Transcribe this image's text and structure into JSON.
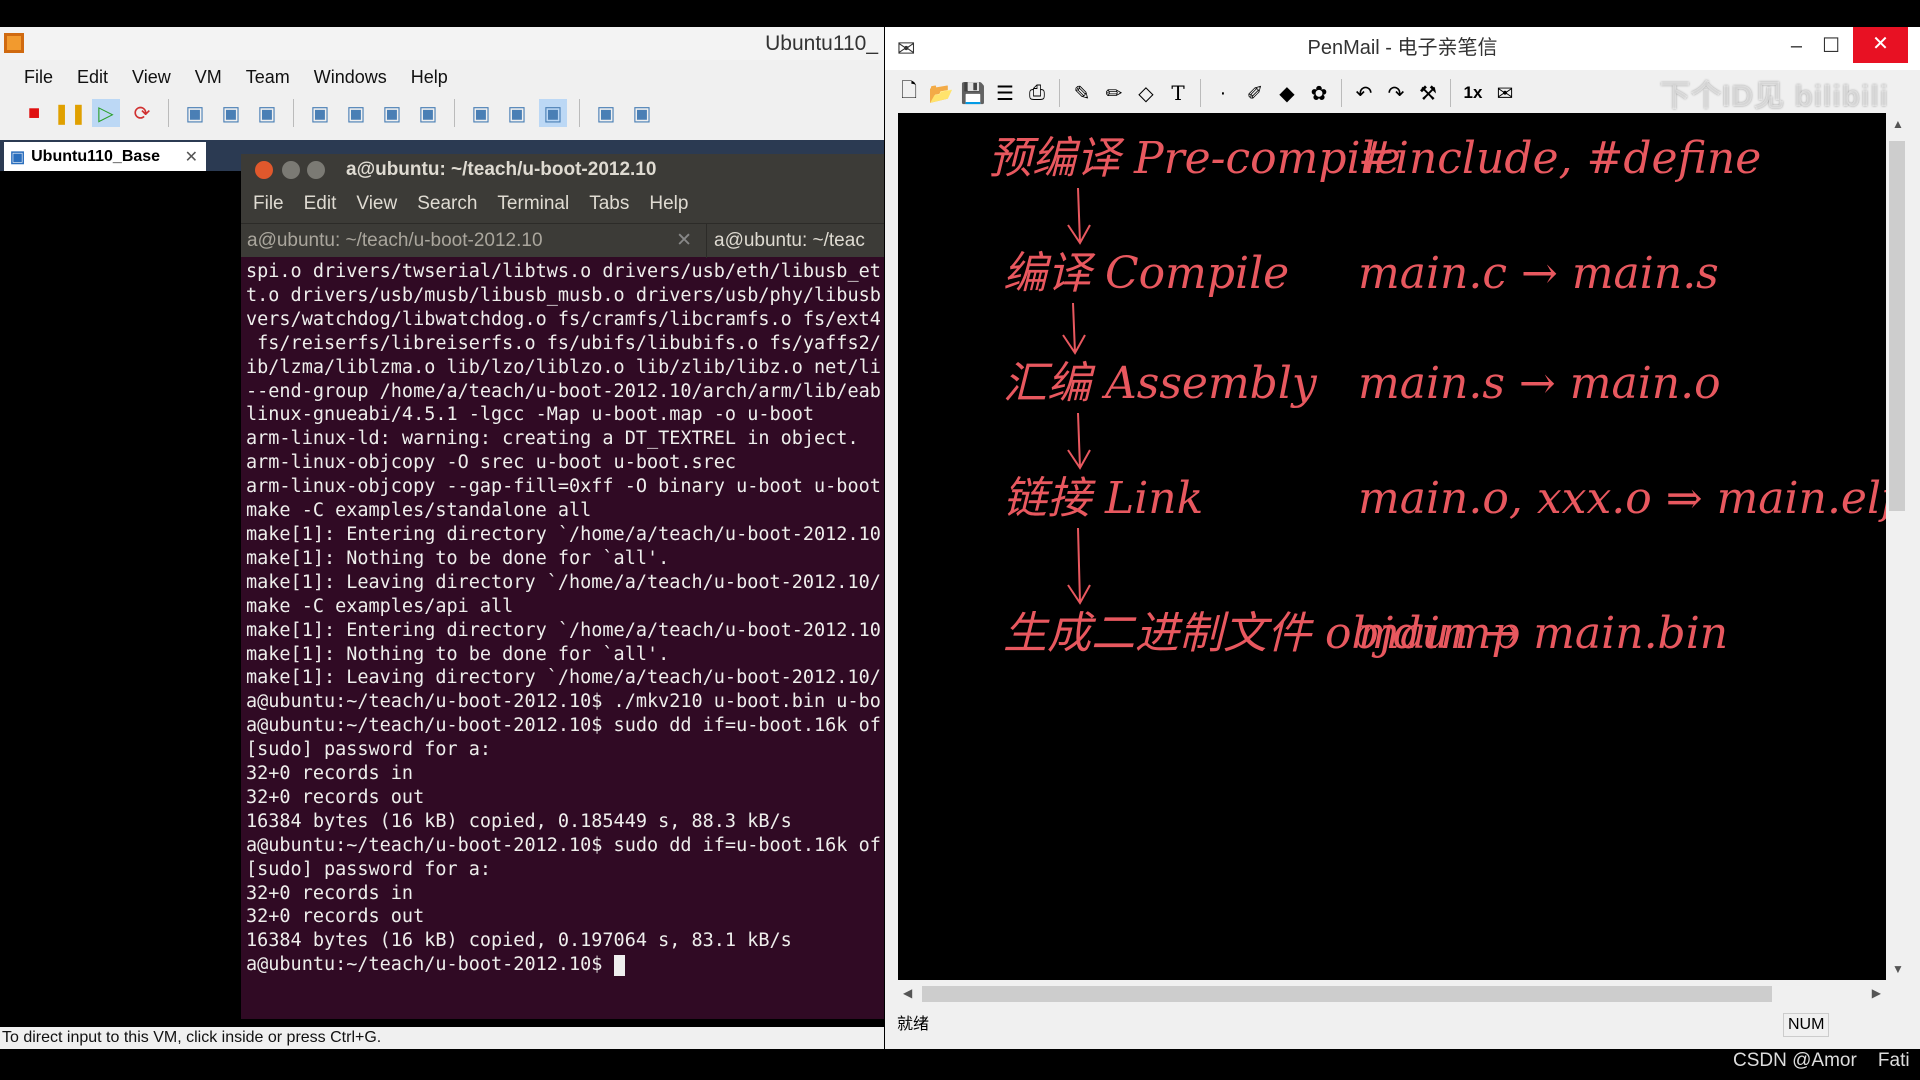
{
  "vmware": {
    "title": "Ubuntu110_",
    "menu": [
      "File",
      "Edit",
      "View",
      "VM",
      "Team",
      "Windows",
      "Help"
    ],
    "toolbar_icons": [
      "stop-icon",
      "pause-icon",
      "play-icon",
      "reset-icon",
      "snapshot-icon",
      "revert-snapshot-icon",
      "snapshot-manager-icon",
      "console-view-icon",
      "fit-guest-icon",
      "full-screen-icon",
      "unity-icon",
      "library-icon",
      "thumbnail-icon",
      "quick-switch-icon",
      "removable-device-icon",
      "share-icon"
    ],
    "tab": "Ubuntu110_Base",
    "status": "To direct input to this VM, click inside or press Ctrl+G."
  },
  "terminal": {
    "title": "a@ubuntu: ~/teach/u-boot-2012.10",
    "menu": [
      "File",
      "Edit",
      "View",
      "Search",
      "Terminal",
      "Tabs",
      "Help"
    ],
    "tabs": [
      "a@ubuntu: ~/teach/u-boot-2012.10",
      "a@ubuntu: ~/teac"
    ],
    "lines": [
      "spi.o drivers/twserial/libtws.o drivers/usb/eth/libusb_et",
      "t.o drivers/usb/musb/libusb_musb.o drivers/usb/phy/libusb",
      "vers/watchdog/libwatchdog.o fs/cramfs/libcramfs.o fs/ext4",
      " fs/reiserfs/libreiserfs.o fs/ubifs/libubifs.o fs/yaffs2/",
      "ib/lzma/liblzma.o lib/lzo/liblzo.o lib/zlib/libz.o net/li",
      "--end-group /home/a/teach/u-boot-2012.10/arch/arm/lib/eab",
      "linux-gnueabi/4.5.1 -lgcc -Map u-boot.map -o u-boot",
      "arm-linux-ld: warning: creating a DT_TEXTREL in object.",
      "arm-linux-objcopy -O srec u-boot u-boot.srec",
      "arm-linux-objcopy --gap-fill=0xff -O binary u-boot u-boot",
      "make -C examples/standalone all",
      "make[1]: Entering directory `/home/a/teach/u-boot-2012.10",
      "make[1]: Nothing to be done for `all'.",
      "make[1]: Leaving directory `/home/a/teach/u-boot-2012.10/",
      "make -C examples/api all",
      "make[1]: Entering directory `/home/a/teach/u-boot-2012.10",
      "make[1]: Nothing to be done for `all'.",
      "make[1]: Leaving directory `/home/a/teach/u-boot-2012.10/",
      "a@ubuntu:~/teach/u-boot-2012.10$ ./mkv210 u-boot.bin u-bo",
      "a@ubuntu:~/teach/u-boot-2012.10$ sudo dd if=u-boot.16k of",
      "[sudo] password for a:",
      "32+0 records in",
      "32+0 records out",
      "16384 bytes (16 kB) copied, 0.185449 s, 88.3 kB/s",
      "a@ubuntu:~/teach/u-boot-2012.10$ sudo dd if=u-boot.16k of",
      "[sudo] password for a:",
      "32+0 records in",
      "32+0 records out",
      "16384 bytes (16 kB) copied, 0.197064 s, 83.1 kB/s"
    ],
    "prompt": "a@ubuntu:~/teach/u-boot-2012.10$ "
  },
  "penmail": {
    "title": "PenMail - 电子亲笔信",
    "toolbar_icons": [
      "new-icon",
      "open-icon",
      "save-icon",
      "properties-icon",
      "print-icon",
      "pen-icon",
      "marker-icon",
      "eraser-icon",
      "text-icon",
      "dot-size-icon",
      "color-pen-icon",
      "fill-icon",
      "stamp-icon",
      "undo-icon",
      "redo-icon",
      "tools-icon",
      "zoom-1x-icon",
      "send-icon"
    ],
    "zoom_label": "1x",
    "text_tool": "T",
    "watermark": "下个ID见 bilibili",
    "notes": [
      {
        "left": "预编译 Pre-compile",
        "right": "#include, #define"
      },
      {
        "left": "编译 Compile",
        "right": "main.c → main.s"
      },
      {
        "left": "汇编 Assembly",
        "right": "main.s → main.o"
      },
      {
        "left": "链接 Link",
        "right": "main.o, xxx.o ⇒ main.elf"
      },
      {
        "left": "生成二进制文件 objdump",
        "right": "main → main.bin"
      }
    ],
    "ink_color": "#e8585f",
    "status": "就绪",
    "num": "NUM"
  },
  "overlay": {
    "credit": "CSDN @Amor",
    "extra": "Fati"
  }
}
